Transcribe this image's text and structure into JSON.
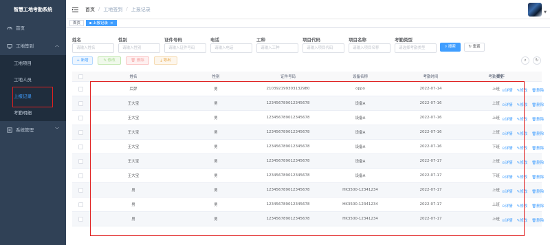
{
  "sidebar": {
    "app_title": "智慧工地考勤系统",
    "items": [
      {
        "label": "首页",
        "icon": "dashboard-icon"
      },
      {
        "label": "工地签到",
        "icon": "monitor-icon",
        "open": true,
        "children": [
          {
            "label": "工地项目"
          },
          {
            "label": "工地人员"
          },
          {
            "label": "上报记录",
            "active": true
          },
          {
            "label": "考勤明细"
          }
        ]
      },
      {
        "label": "系统管理",
        "icon": "settings-icon"
      }
    ]
  },
  "header": {
    "breadcrumb": [
      "首页",
      "工地签到",
      "上报记录"
    ]
  },
  "tags": [
    {
      "label": "首页"
    },
    {
      "label": "上报记录",
      "active": true
    }
  ],
  "search": {
    "fields": [
      {
        "label": "姓名",
        "placeholder": "请输入姓名"
      },
      {
        "label": "性别",
        "placeholder": "请输入性别"
      },
      {
        "label": "证件号码",
        "placeholder": "请输入证件号码"
      },
      {
        "label": "电话",
        "placeholder": "请输入电话"
      },
      {
        "label": "工种",
        "placeholder": "请输入工种"
      },
      {
        "label": "项目代码",
        "placeholder": "请输入项目代码"
      },
      {
        "label": "项目名称",
        "placeholder": "请输入项目名称"
      },
      {
        "label": "考勤类型",
        "placeholder": "请选择考勤类型"
      }
    ],
    "search_label": "搜索",
    "reset_label": "重置"
  },
  "toolbar": {
    "add": "新增",
    "edit": "修改",
    "delete": "删除",
    "export": "导出"
  },
  "table": {
    "headers": [
      "姓名",
      "性别",
      "证件号码",
      "设备名称",
      "考勤时间",
      "考勤类型",
      "操作"
    ],
    "op_labels": {
      "detail": "详情",
      "edit": "修改",
      "delete": "删除"
    },
    "rows": [
      [
        "后羿",
        "男",
        "210392199303132980",
        "oppo",
        "2022-07-14",
        "上班"
      ],
      [
        "王大宝",
        "男",
        "123456789012345678",
        "设备A",
        "2022-07-16",
        "上班"
      ],
      [
        "王大宝",
        "男",
        "123456789012345678",
        "设备A",
        "2022-07-16",
        "上班"
      ],
      [
        "王大宝",
        "男",
        "123456789012345678",
        "设备A",
        "2022-07-16",
        "上班"
      ],
      [
        "王大宝",
        "男",
        "123456789012345678",
        "设备A",
        "2022-07-16",
        "下班"
      ],
      [
        "王大宝",
        "男",
        "123456789012345678",
        "设备A",
        "2022-07-17",
        "上班"
      ],
      [
        "王大宝",
        "男",
        "123456789012345678",
        "设备A",
        "2022-07-17",
        "下班"
      ],
      [
        "男",
        "男",
        "123456789012345678",
        "HK3500-12341234",
        "2022-07-17",
        "上班"
      ],
      [
        "男",
        "男",
        "123456789012345678",
        "HK3500-12341234",
        "2022-07-17",
        "上班"
      ],
      [
        "男",
        "男",
        "123456789012345678",
        "HK3500-12341234",
        "2022-07-17",
        "上班"
      ]
    ]
  },
  "colors": {
    "primary": "#409eff",
    "sidebar_bg": "#304156",
    "highlight_box": "#e02020"
  }
}
